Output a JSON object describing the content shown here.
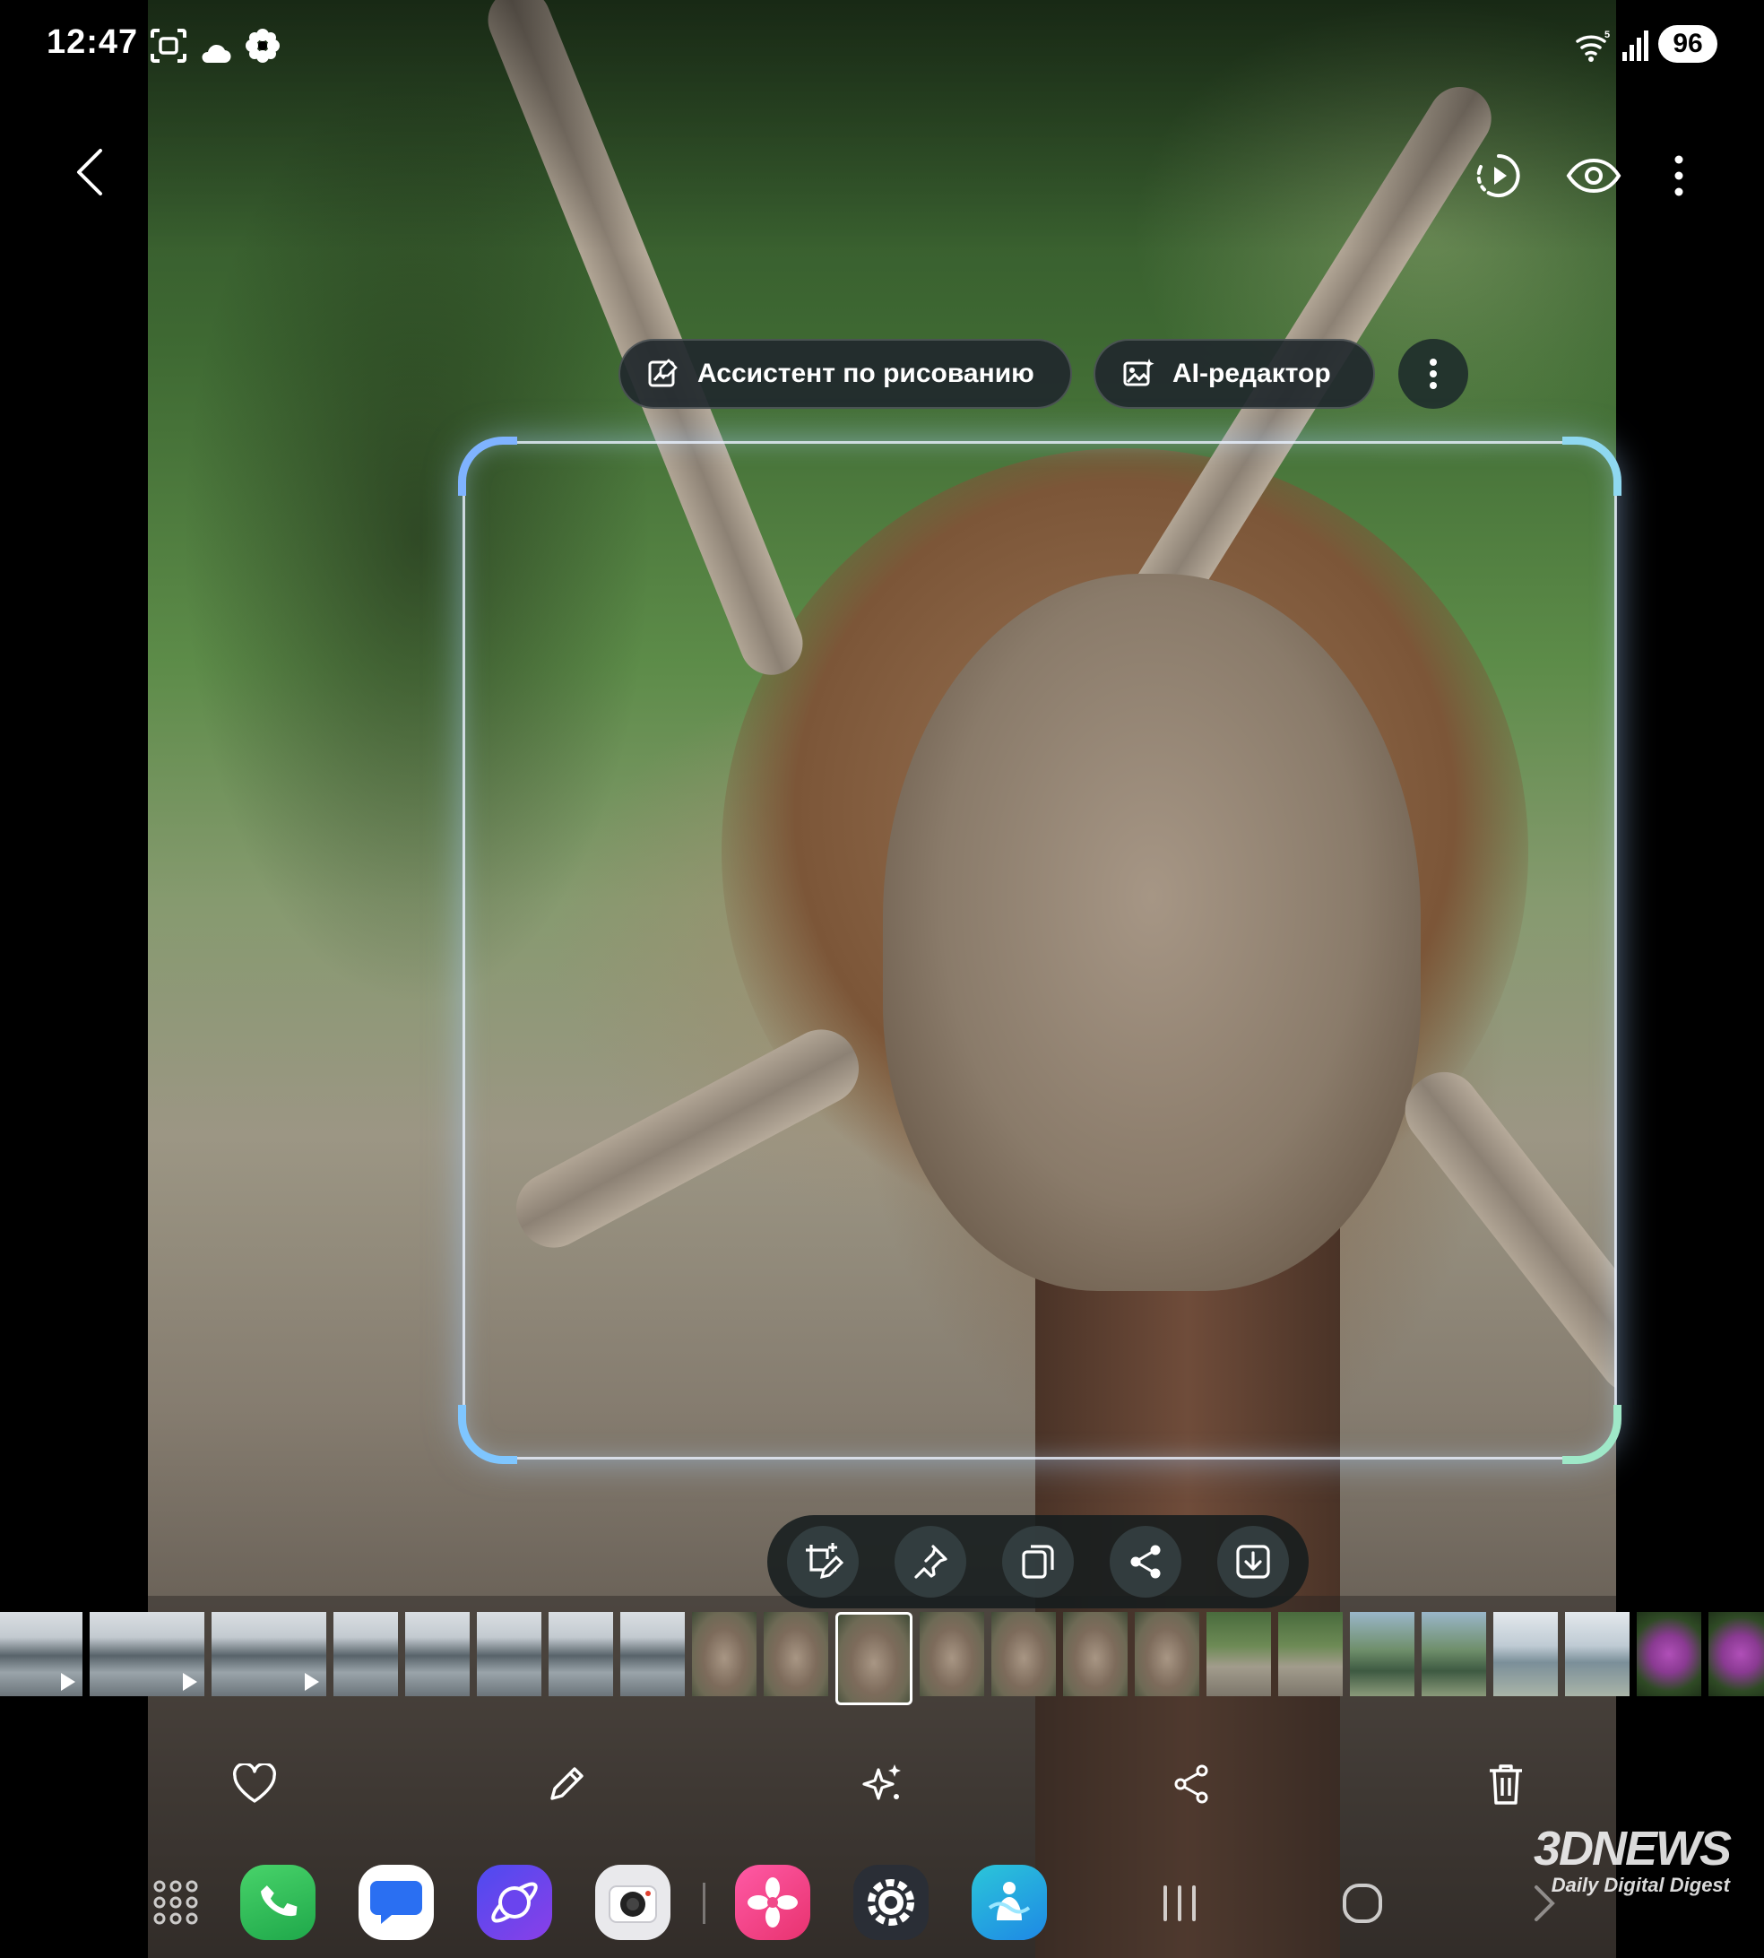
{
  "status_bar": {
    "time": "12:47",
    "battery": "96",
    "icons": [
      "screenshot-icon",
      "cloud-icon",
      "flower-icon",
      "wifi-icon",
      "signal-icon"
    ]
  },
  "top_bar": {
    "back_icon": "chevron-left-icon",
    "actions": [
      "motion-photo-icon",
      "eye-icon",
      "more-vertical-icon"
    ]
  },
  "chips": {
    "drawing_assistant": "Ассистент по рисованию",
    "ai_editor": "AI-редактор",
    "more_icon": "more-vertical-icon"
  },
  "selection_actions": [
    "edit-crop-icon",
    "pin-icon",
    "copy-icon",
    "share-icon",
    "save-icon"
  ],
  "filmstrip": {
    "thumbnails": [
      {
        "kind": "canal",
        "video": true
      },
      {
        "kind": "canal",
        "video": true
      },
      {
        "kind": "canal",
        "video": true
      },
      {
        "kind": "canal",
        "video": false
      },
      {
        "kind": "canal",
        "video": false
      },
      {
        "kind": "canal",
        "video": false
      },
      {
        "kind": "canal",
        "video": false
      },
      {
        "kind": "canal",
        "video": false
      },
      {
        "kind": "snail",
        "video": false
      },
      {
        "kind": "snail",
        "video": false
      },
      {
        "kind": "snail",
        "video": false,
        "current": true
      },
      {
        "kind": "snail",
        "video": false
      },
      {
        "kind": "snail",
        "video": false
      },
      {
        "kind": "snail",
        "video": false
      },
      {
        "kind": "snail",
        "video": false
      },
      {
        "kind": "path",
        "video": false
      },
      {
        "kind": "path",
        "video": false
      },
      {
        "kind": "person",
        "video": false
      },
      {
        "kind": "person",
        "video": false
      },
      {
        "kind": "river",
        "video": false
      },
      {
        "kind": "river",
        "video": false
      },
      {
        "kind": "flower",
        "video": false
      },
      {
        "kind": "flower",
        "video": false
      }
    ]
  },
  "toolbar": [
    "heart-icon",
    "pencil-icon",
    "sparkle-icon",
    "share-icon",
    "trash-icon"
  ],
  "dock": {
    "apps": [
      "apps-grid-icon",
      "phone-app-icon",
      "messages-app-icon",
      "internet-app-icon",
      "camera-app-icon",
      "gallery-app-icon",
      "settings-app-icon",
      "bixby-app-icon"
    ],
    "nav": [
      "recents-icon",
      "home-icon",
      "back-nav-icon"
    ]
  },
  "watermark": {
    "brand": "3DNEWS",
    "tagline": "Daily Digital Digest"
  }
}
